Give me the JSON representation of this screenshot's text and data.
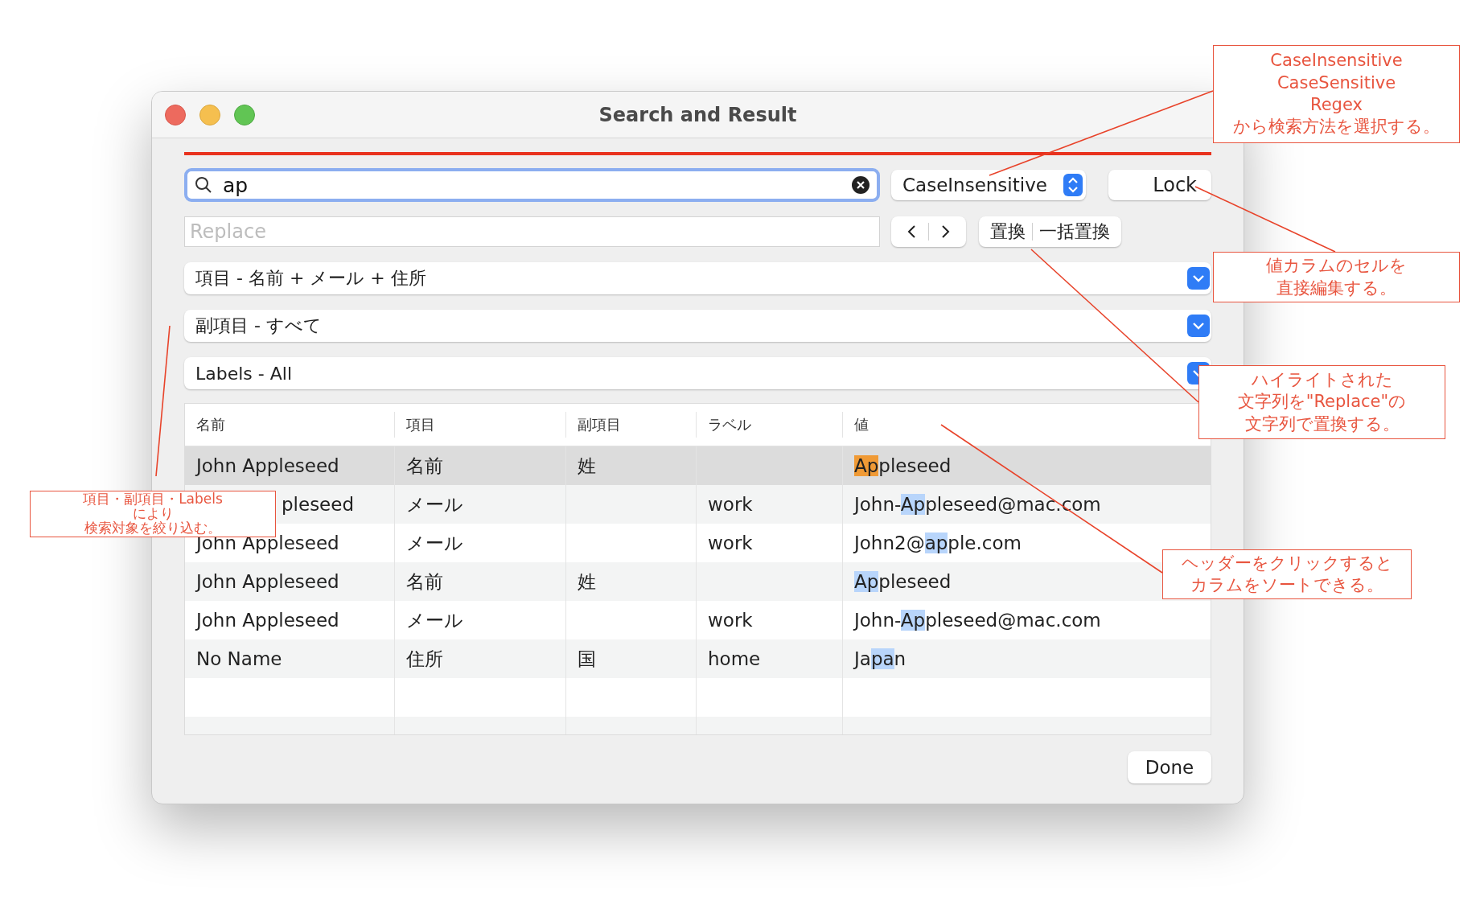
{
  "window": {
    "title": "Search and Result"
  },
  "search": {
    "value": "ap"
  },
  "mode_popup": {
    "value": "CaseInsensitive"
  },
  "lock_button": "Lock",
  "replace": {
    "placeholder": "Replace"
  },
  "replace_buttons": [
    "置換",
    "一括置換"
  ],
  "filters": [
    {
      "label": "項目 - 名前 + メール + 住所"
    },
    {
      "label": "副項目 - すべて"
    },
    {
      "label": "Labels - All"
    }
  ],
  "table": {
    "columns": [
      "名前",
      "項目",
      "副項目",
      "ラベル",
      "値"
    ],
    "rows": [
      {
        "selected": true,
        "name": "John Appleseed",
        "item": "名前",
        "subitem": "姓",
        "value": {
          "match": "Ap",
          "after": "pleseed",
          "current": true
        }
      },
      {
        "selected": false,
        "name": "pleseed",
        "item": "メール",
        "label": "work",
        "value": {
          "before": "John-",
          "match": "Ap",
          "after": "pleseed@mac.com",
          "current": false
        }
      },
      {
        "selected": false,
        "name": "John Appleseed",
        "item": "メール",
        "label": "work",
        "value": {
          "before": "John2@",
          "match": "ap",
          "after": "ple.com",
          "current": false
        }
      },
      {
        "selected": false,
        "name": "John Appleseed",
        "item": "名前",
        "subitem": "姓",
        "value": {
          "match": "Ap",
          "after": "pleseed",
          "current": false
        }
      },
      {
        "selected": false,
        "name": "John Appleseed",
        "item": "メール",
        "label": "work",
        "value": {
          "before": "John-",
          "match": "Ap",
          "after": "pleseed@mac.com",
          "current": false
        }
      },
      {
        "selected": false,
        "name": "No Name",
        "item": "住所",
        "subitem": "国",
        "label": "home",
        "value": {
          "before": "Ja",
          "match": "pa",
          "after": "n",
          "current": false
        }
      }
    ]
  },
  "done_button": "Done",
  "annotations": [
    {
      "lines": [
        "CaseInsensitive",
        "CaseSensitive",
        "Regex",
        "から検索方法を選択する。"
      ]
    },
    {
      "lines": [
        "値カラムのセルを",
        "直接編集する。"
      ]
    },
    {
      "lines": [
        "ハイライトされた",
        "文字列を\"Replace\"の",
        "文字列で置換する。"
      ]
    },
    {
      "lines": [
        "ヘッダーをクリックすると",
        "カラムをソートできる。"
      ]
    },
    {
      "lines": [
        "項目・副項目・Labels",
        "により",
        "検索対象を絞り込む。"
      ]
    }
  ]
}
